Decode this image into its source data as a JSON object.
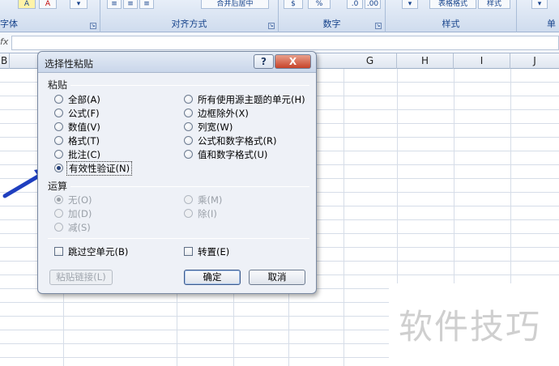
{
  "ribbon": {
    "groups": [
      {
        "label": "字体"
      },
      {
        "label": "对齐方式"
      },
      {
        "label": "数字"
      },
      {
        "label": "样式"
      },
      {
        "label": "单"
      }
    ],
    "buttons": {
      "merge_center": "合并后居中",
      "percent": "%",
      "table_format": "表格格式",
      "cell_style": "样式"
    }
  },
  "formula_bar": {
    "fx_label": "fx",
    "value": ""
  },
  "columns": [
    "B",
    "H",
    "I",
    "J",
    "G"
  ],
  "dialog": {
    "title": "选择性粘贴",
    "help_label": "?",
    "close_label": "X",
    "paste": {
      "label": "粘贴",
      "left_options": [
        "全部(A)",
        "公式(F)",
        "数值(V)",
        "格式(T)",
        "批注(C)",
        "有效性验证(N)"
      ],
      "right_options": [
        "所有使用源主题的单元(H)",
        "边框除外(X)",
        "列宽(W)",
        "公式和数字格式(R)",
        "值和数字格式(U)"
      ],
      "selected": "有效性验证(N)"
    },
    "operation": {
      "label": "运算",
      "left_options": [
        "无(O)",
        "加(D)",
        "减(S)"
      ],
      "right_options": [
        "乘(M)",
        "除(I)"
      ]
    },
    "checkboxes": {
      "skip_blanks": "跳过空单元(B)",
      "transpose": "转置(E)"
    },
    "buttons": {
      "paste_link": "粘贴链接(L)",
      "ok": "确定",
      "cancel": "取消"
    }
  },
  "watermark": "软件技巧",
  "colors": {
    "arrow": "#1f3fbf",
    "accent": "#15428b"
  }
}
